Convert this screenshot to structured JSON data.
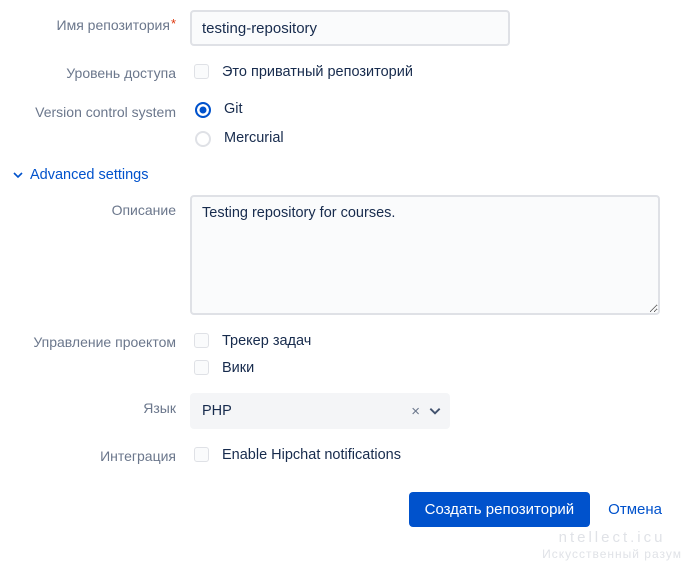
{
  "repo_name": {
    "label": "Имя репозитория",
    "value": "testing-repository"
  },
  "access": {
    "label": "Уровень доступа",
    "option": "Это приватный репозиторий",
    "checked": false
  },
  "vcs": {
    "label": "Version control system",
    "options": [
      {
        "label": "Git",
        "checked": true
      },
      {
        "label": "Mercurial",
        "checked": false
      }
    ]
  },
  "advanced": {
    "label": "Advanced settings",
    "expanded": true
  },
  "description": {
    "label": "Описание",
    "value": "Testing repository for courses."
  },
  "project_mgmt": {
    "label": "Управление проектом",
    "options": [
      {
        "label": "Трекер задач",
        "checked": false
      },
      {
        "label": "Вики",
        "checked": false
      }
    ]
  },
  "language": {
    "label": "Язык",
    "value": "PHP"
  },
  "integration": {
    "label": "Интеграция",
    "option": "Enable Hipchat notifications",
    "checked": false
  },
  "actions": {
    "submit": "Создать репозиторий",
    "cancel": "Отмена"
  },
  "watermark": {
    "top": "ntellect.icu",
    "bottom": "Искусственный разум"
  }
}
